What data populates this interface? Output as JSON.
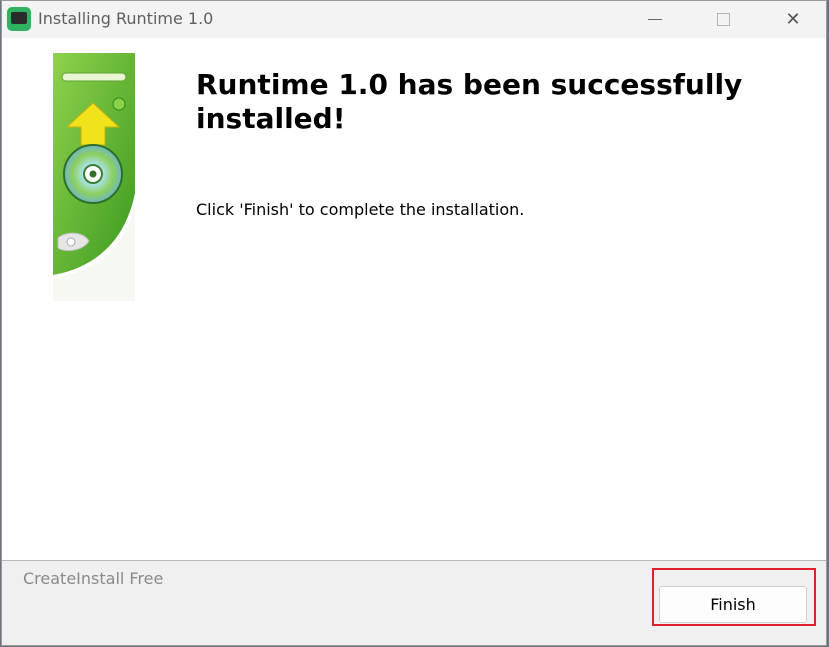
{
  "window": {
    "title": "Installing Runtime 1.0",
    "icon": "app-monitor-icon"
  },
  "controls": {
    "minimize_icon": "minimize-icon",
    "maximize_icon": "maximize-icon",
    "close_icon": "close-icon",
    "close_glyph": "✕"
  },
  "main": {
    "heading": "Runtime 1.0 has been successfully installed!",
    "instruction": "Click 'Finish' to complete the installation.",
    "banner_icon": "install-banner-cd-arrow"
  },
  "footer": {
    "brand": "CreateInstall Free",
    "finish_label": "Finish"
  },
  "colors": {
    "accent_green": "#5cb82e",
    "arrow_yellow": "#f2e21b",
    "highlight_red": "#e0202a"
  }
}
